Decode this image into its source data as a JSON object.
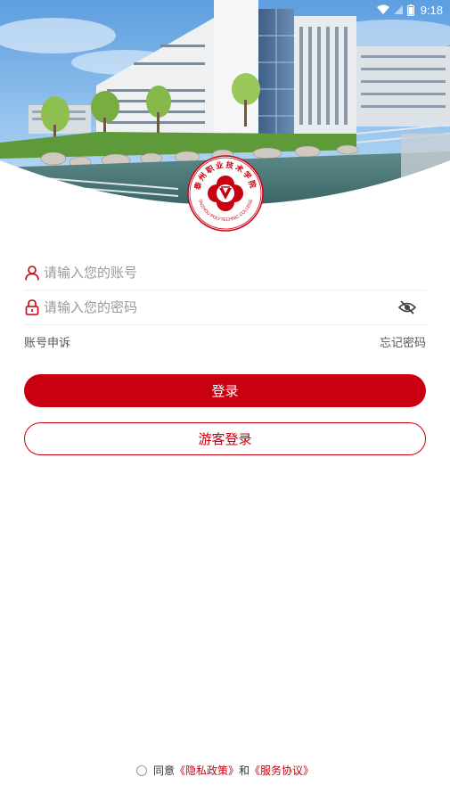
{
  "status_bar": {
    "time": "9:18",
    "icons": [
      "wifi-icon",
      "signal-icon",
      "battery-icon"
    ]
  },
  "login": {
    "account_placeholder": "请输入您的账号",
    "password_placeholder": "请输入您的密码",
    "appeal_label": "账号申诉",
    "forgot_label": "忘记密码",
    "login_button": "登录",
    "guest_button": "游客登录"
  },
  "emblem": {
    "name_cn": "泰州职业技术学院",
    "name_en": "TAIZHOU POLYTECHNIC COLLEGE"
  },
  "agreement": {
    "prefix": "同意",
    "privacy": "《隐私政策》",
    "conjunction": "和",
    "terms": "《服务协议》"
  },
  "theme": {
    "accent": "#c9000f",
    "text": "#333333",
    "placeholder": "#9a9a9a",
    "divider": "#eeeeee"
  }
}
